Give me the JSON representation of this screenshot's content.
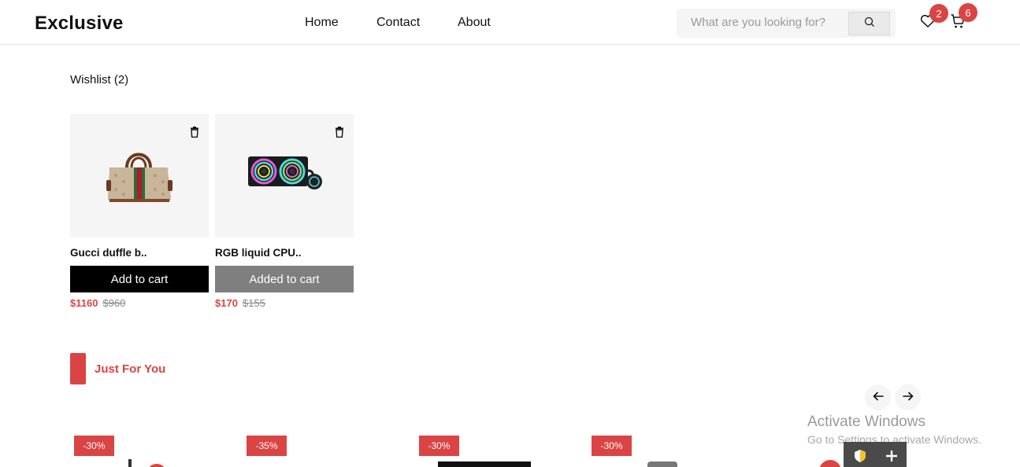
{
  "header": {
    "logo": "Exclusive",
    "nav": [
      {
        "label": "Home"
      },
      {
        "label": "Contact"
      },
      {
        "label": "About"
      }
    ],
    "search": {
      "placeholder": "What are you looking for?"
    },
    "wishlist_count": "2",
    "cart_count": "6"
  },
  "wishlist": {
    "title": "Wishlist (2)",
    "items": [
      {
        "name": "Gucci duffle b..",
        "button": "Add to cart",
        "price": "$1160",
        "old_price": "$960",
        "image": "gucci-duffle-bag"
      },
      {
        "name": "RGB liquid CPU..",
        "button": "Added to cart",
        "price": "$170",
        "old_price": "$155",
        "image": "rgb-liquid-cpu-cooler"
      }
    ]
  },
  "just_for_you": {
    "label": "Just For You",
    "discounts": [
      "-30%",
      "-35%",
      "-30%",
      "-30%"
    ]
  },
  "watermark": {
    "title": "Activate Windows",
    "subtitle": "Go to Settings to activate Windows."
  },
  "colors": {
    "accent": "#db4444",
    "button_dark": "#000000",
    "button_added": "#7f7f7f",
    "card_bg": "#f5f5f5"
  }
}
